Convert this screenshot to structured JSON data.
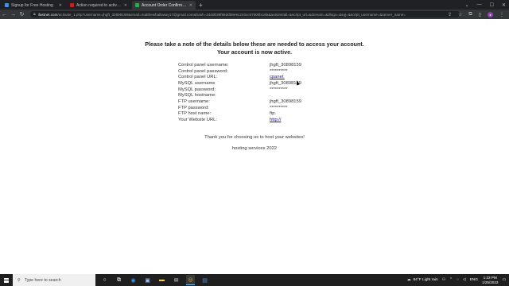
{
  "browser": {
    "tabs": [
      {
        "title": "Signup for Free Hosting",
        "favicon_color": "#4a90d9",
        "active": false
      },
      {
        "title": "Action required to activate host...",
        "favicon_color": "#c5221f",
        "active": false
      },
      {
        "title": "Account Order Confirmation",
        "favicon_color": "#34a853",
        "active": true
      }
    ],
    "new_tab_label": "+",
    "url_host": "ifastnet.com",
    "url_rest": "/activate_1.php?username=jhgft_30898159&email=matthewhallaway17@gmail.com&hash=34dd038f65dd08e9c243cc67500bcafa&autoinstall=&script_url=&domain=&dlogo=&sqj=&script_username=&server_name="
  },
  "page": {
    "heading_line1": "Please take a note of the details below these are needed to access your account.",
    "heading_line2": "Your account is now active.",
    "details": [
      {
        "label": "Control panel username:",
        "value": "jhgft_30898159",
        "link": false
      },
      {
        "label": "Control panel password:",
        "value": "**********",
        "link": false
      },
      {
        "label": "Control panel URL:",
        "value": "cpanel.",
        "link": true
      },
      {
        "label": "MySQL username",
        "value": "jhgft_30898159",
        "link": false
      },
      {
        "label": "MySQL password:",
        "value": "**********",
        "link": false
      },
      {
        "label": "MySQL hostname:",
        "value": ".",
        "link": false
      },
      {
        "label": "FTP username:",
        "value": "jhgft_30898159",
        "link": false
      },
      {
        "label": "FTP password:",
        "value": "**********",
        "link": false
      },
      {
        "label": "FTP host name:",
        "value": "ftp.",
        "link": false
      },
      {
        "label": "Your Website URL:",
        "value": "http://",
        "link": true
      }
    ],
    "thanks": "Thank you for choosing us to host your websites!",
    "footer": "hosting services 2022"
  },
  "taskbar": {
    "search_placeholder": "Type here to search",
    "weather": "84°F  Light rain",
    "language": "ENG",
    "time": "1:23 PM",
    "date": "1/25/2023"
  }
}
